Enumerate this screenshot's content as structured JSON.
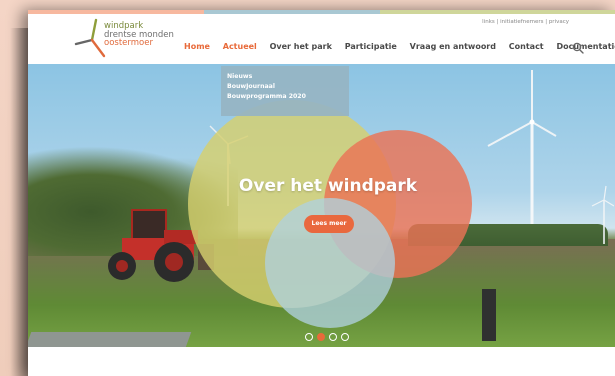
{
  "brand": {
    "line1": "windpark",
    "line2": "drentse monden",
    "line3": "oostermoer",
    "accent": "#e86a3a"
  },
  "utility": {
    "links": "links",
    "sep1": " | ",
    "initiatiefnemers": "initiatiefnemers",
    "sep2": " | ",
    "privacy": "privacy"
  },
  "nav": {
    "items": [
      {
        "label": "Home",
        "active": true
      },
      {
        "label": "Actueel",
        "active": true
      },
      {
        "label": "Over het park",
        "active": false
      },
      {
        "label": "Participatie",
        "active": false
      },
      {
        "label": "Vraag en antwoord",
        "active": false
      },
      {
        "label": "Contact",
        "active": false
      },
      {
        "label": "Documentatie",
        "active": false
      }
    ],
    "search_icon": "search-icon"
  },
  "dropdown": {
    "items": [
      "Nieuws",
      "BouwJournaal",
      "Bouwprogramma 2020"
    ]
  },
  "hero": {
    "title": "Over het windpark",
    "cta": "Lees meer",
    "slides_total": 4,
    "slide_active": 2
  },
  "colors": {
    "circle_yellow": "#d6d06e",
    "circle_orange": "#ea7355",
    "circle_blue": "#b0d1de"
  }
}
